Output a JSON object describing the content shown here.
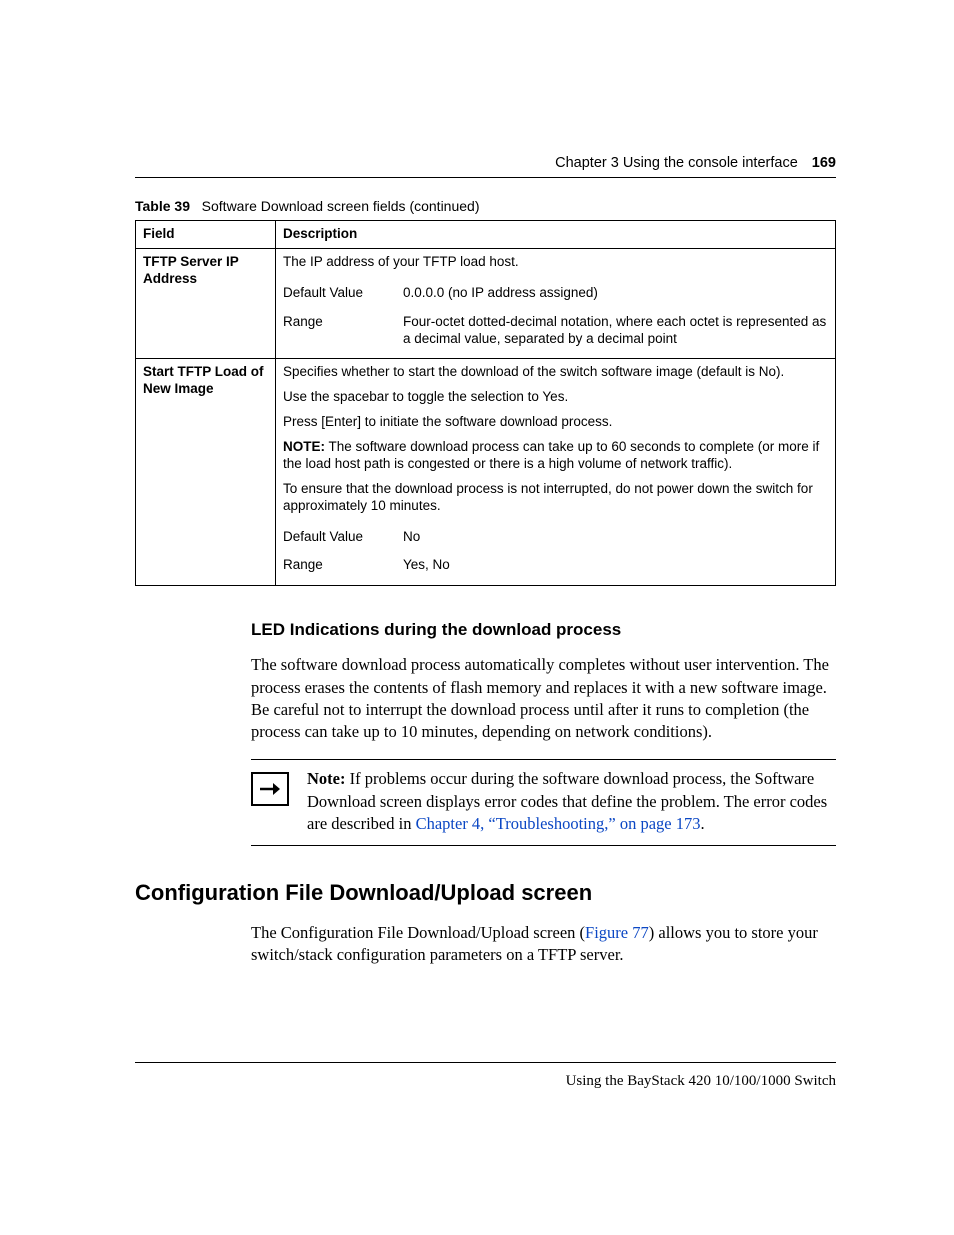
{
  "header": {
    "chapter": "Chapter 3  Using the console interface",
    "page_number": "169"
  },
  "table_caption": {
    "number": "Table 39",
    "text": "Software Download screen fields (continued)"
  },
  "table_headers": {
    "field": "Field",
    "description": "Description"
  },
  "row1": {
    "field": "TFTP Server IP Address",
    "desc": "The IP address of your TFTP load host.",
    "default_label": "Default Value",
    "default_value": "0.0.0.0 (no IP address assigned)",
    "range_label": "Range",
    "range_value": "Four-octet dotted-decimal notation, where each octet is represented as a decimal value, separated by a decimal point"
  },
  "row2": {
    "field": "Start TFTP Load of New Image",
    "p1": "Specifies whether to start the download of the switch software image (default is No).",
    "p2": "Use the spacebar to toggle the selection to Yes.",
    "p3": "Press [Enter] to initiate the software download process.",
    "note_label": "NOTE:",
    "note_text": " The software download process can take up to 60 seconds to complete (or more if the load host path is congested or there is a high volume of network traffic).",
    "p5": "To ensure that the download process is not interrupted, do not power down the switch for approximately 10 minutes.",
    "default_label": "Default Value",
    "default_value": "No",
    "range_label": "Range",
    "range_value": "Yes, No"
  },
  "section_h3": "LED Indications during the download process",
  "para1": "The software download process automatically completes without user intervention. The process erases the contents of flash memory and replaces it with a new software image. Be careful not to interrupt the download process until after it runs to completion (the process can take up to 10 minutes, depending on network conditions).",
  "note_box": {
    "label": "Note:",
    "body": " If problems occur during the software download process, the Software Download screen displays error codes that define the problem. The error codes are described in ",
    "link": "Chapter 4, “Troubleshooting,” on page 173",
    "tail": "."
  },
  "section_h2": "Configuration File Download/Upload screen",
  "para2_a": "The Configuration File Download/Upload screen (",
  "para2_link": "Figure 77",
  "para2_b": ") allows you to store your switch/stack configuration parameters on a TFTP server.",
  "footer": {
    "text": "Using the BayStack 420 10/100/1000 Switch"
  }
}
